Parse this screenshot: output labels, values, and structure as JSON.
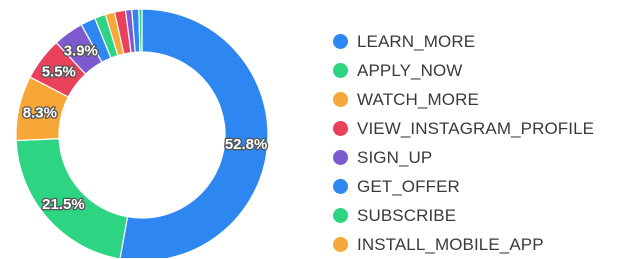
{
  "chart_data": {
    "type": "pie",
    "variant": "donut",
    "legend_position": "right",
    "series": [
      {
        "name": "LEARN_MORE",
        "value": 52.8,
        "color": "#2e87f0",
        "label": "52.8%"
      },
      {
        "name": "SUBSCRIBE",
        "value": 21.5,
        "color": "#2dd481",
        "label": "21.5%"
      },
      {
        "name": "INSTALL_MOBILE_APP",
        "value": 8.3,
        "color": "#f7a638",
        "label": "8.3%"
      },
      {
        "name": "VIEW_INSTAGRAM_PROFILE",
        "value": 5.5,
        "color": "#e9415a",
        "label": "5.5%"
      },
      {
        "name": "SIGN_UP",
        "value": 3.9,
        "color": "#7d5ad0",
        "label": "3.9%"
      },
      {
        "name": "GET_OFFER",
        "value": 1.9,
        "color": "#2e87f0",
        "label": ""
      },
      {
        "name": "APPLY_NOW",
        "value": 1.4,
        "color": "#2dd481",
        "label": ""
      },
      {
        "name": "WATCH_MORE",
        "value": 1.2,
        "color": "#f7a638",
        "label": ""
      },
      {
        "name": "VIEW_INSTAGRAM_PROFILE",
        "value": 1.4,
        "color": "#e9415a",
        "label": ""
      },
      {
        "name": "SIGN_UP",
        "value": 0.8,
        "color": "#7d5ad0",
        "label": ""
      },
      {
        "name": "GET_OFFER",
        "value": 0.9,
        "color": "#2e87f0",
        "label": ""
      },
      {
        "name": "SUBSCRIBE",
        "value": 0.4,
        "color": "#2dd481",
        "label": ""
      }
    ],
    "legend": [
      {
        "name": "LEARN_MORE",
        "color": "#2e87f0"
      },
      {
        "name": "APPLY_NOW",
        "color": "#2dd481"
      },
      {
        "name": "WATCH_MORE",
        "color": "#f7a638"
      },
      {
        "name": "VIEW_INSTAGRAM_PROFILE",
        "color": "#e9415a"
      },
      {
        "name": "SIGN_UP",
        "color": "#7d5ad0"
      },
      {
        "name": "GET_OFFER",
        "color": "#2e87f0"
      },
      {
        "name": "SUBSCRIBE",
        "color": "#2dd481"
      },
      {
        "name": "INSTALL_MOBILE_APP",
        "color": "#f7a638"
      }
    ]
  }
}
